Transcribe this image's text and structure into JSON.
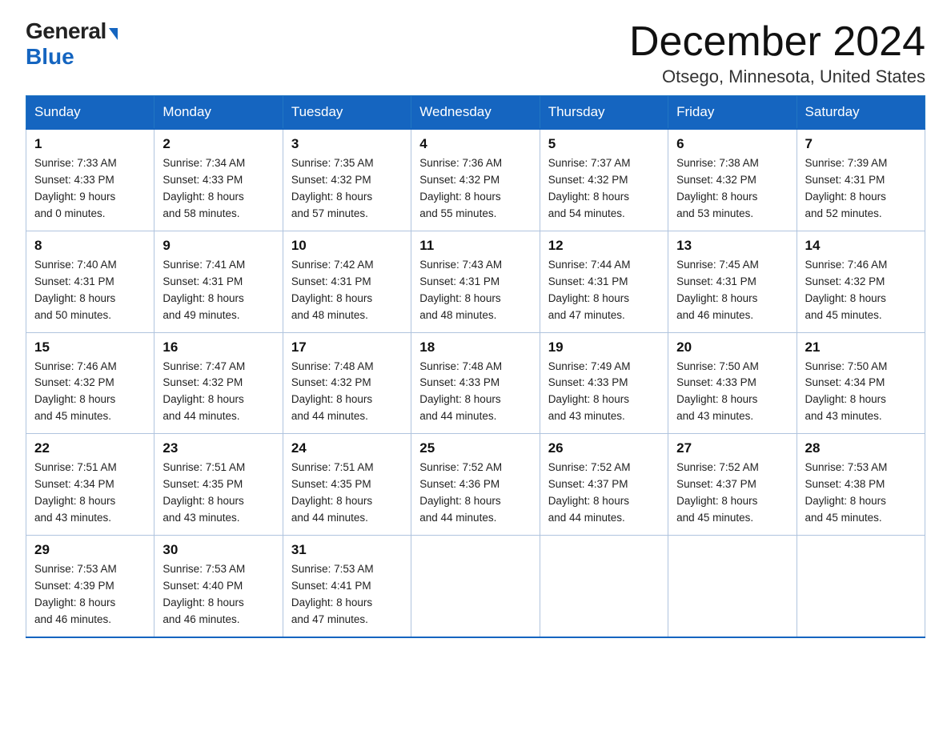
{
  "logo": {
    "general": "General",
    "blue": "Blue",
    "triangle": "▲"
  },
  "title": "December 2024",
  "location": "Otsego, Minnesota, United States",
  "days_of_week": [
    "Sunday",
    "Monday",
    "Tuesday",
    "Wednesday",
    "Thursday",
    "Friday",
    "Saturday"
  ],
  "weeks": [
    [
      {
        "day": "1",
        "sunrise": "7:33 AM",
        "sunset": "4:33 PM",
        "daylight": "9 hours and 0 minutes."
      },
      {
        "day": "2",
        "sunrise": "7:34 AM",
        "sunset": "4:33 PM",
        "daylight": "8 hours and 58 minutes."
      },
      {
        "day": "3",
        "sunrise": "7:35 AM",
        "sunset": "4:32 PM",
        "daylight": "8 hours and 57 minutes."
      },
      {
        "day": "4",
        "sunrise": "7:36 AM",
        "sunset": "4:32 PM",
        "daylight": "8 hours and 55 minutes."
      },
      {
        "day": "5",
        "sunrise": "7:37 AM",
        "sunset": "4:32 PM",
        "daylight": "8 hours and 54 minutes."
      },
      {
        "day": "6",
        "sunrise": "7:38 AM",
        "sunset": "4:32 PM",
        "daylight": "8 hours and 53 minutes."
      },
      {
        "day": "7",
        "sunrise": "7:39 AM",
        "sunset": "4:31 PM",
        "daylight": "8 hours and 52 minutes."
      }
    ],
    [
      {
        "day": "8",
        "sunrise": "7:40 AM",
        "sunset": "4:31 PM",
        "daylight": "8 hours and 50 minutes."
      },
      {
        "day": "9",
        "sunrise": "7:41 AM",
        "sunset": "4:31 PM",
        "daylight": "8 hours and 49 minutes."
      },
      {
        "day": "10",
        "sunrise": "7:42 AM",
        "sunset": "4:31 PM",
        "daylight": "8 hours and 48 minutes."
      },
      {
        "day": "11",
        "sunrise": "7:43 AM",
        "sunset": "4:31 PM",
        "daylight": "8 hours and 48 minutes."
      },
      {
        "day": "12",
        "sunrise": "7:44 AM",
        "sunset": "4:31 PM",
        "daylight": "8 hours and 47 minutes."
      },
      {
        "day": "13",
        "sunrise": "7:45 AM",
        "sunset": "4:31 PM",
        "daylight": "8 hours and 46 minutes."
      },
      {
        "day": "14",
        "sunrise": "7:46 AM",
        "sunset": "4:32 PM",
        "daylight": "8 hours and 45 minutes."
      }
    ],
    [
      {
        "day": "15",
        "sunrise": "7:46 AM",
        "sunset": "4:32 PM",
        "daylight": "8 hours and 45 minutes."
      },
      {
        "day": "16",
        "sunrise": "7:47 AM",
        "sunset": "4:32 PM",
        "daylight": "8 hours and 44 minutes."
      },
      {
        "day": "17",
        "sunrise": "7:48 AM",
        "sunset": "4:32 PM",
        "daylight": "8 hours and 44 minutes."
      },
      {
        "day": "18",
        "sunrise": "7:48 AM",
        "sunset": "4:33 PM",
        "daylight": "8 hours and 44 minutes."
      },
      {
        "day": "19",
        "sunrise": "7:49 AM",
        "sunset": "4:33 PM",
        "daylight": "8 hours and 43 minutes."
      },
      {
        "day": "20",
        "sunrise": "7:50 AM",
        "sunset": "4:33 PM",
        "daylight": "8 hours and 43 minutes."
      },
      {
        "day": "21",
        "sunrise": "7:50 AM",
        "sunset": "4:34 PM",
        "daylight": "8 hours and 43 minutes."
      }
    ],
    [
      {
        "day": "22",
        "sunrise": "7:51 AM",
        "sunset": "4:34 PM",
        "daylight": "8 hours and 43 minutes."
      },
      {
        "day": "23",
        "sunrise": "7:51 AM",
        "sunset": "4:35 PM",
        "daylight": "8 hours and 43 minutes."
      },
      {
        "day": "24",
        "sunrise": "7:51 AM",
        "sunset": "4:35 PM",
        "daylight": "8 hours and 44 minutes."
      },
      {
        "day": "25",
        "sunrise": "7:52 AM",
        "sunset": "4:36 PM",
        "daylight": "8 hours and 44 minutes."
      },
      {
        "day": "26",
        "sunrise": "7:52 AM",
        "sunset": "4:37 PM",
        "daylight": "8 hours and 44 minutes."
      },
      {
        "day": "27",
        "sunrise": "7:52 AM",
        "sunset": "4:37 PM",
        "daylight": "8 hours and 45 minutes."
      },
      {
        "day": "28",
        "sunrise": "7:53 AM",
        "sunset": "4:38 PM",
        "daylight": "8 hours and 45 minutes."
      }
    ],
    [
      {
        "day": "29",
        "sunrise": "7:53 AM",
        "sunset": "4:39 PM",
        "daylight": "8 hours and 46 minutes."
      },
      {
        "day": "30",
        "sunrise": "7:53 AM",
        "sunset": "4:40 PM",
        "daylight": "8 hours and 46 minutes."
      },
      {
        "day": "31",
        "sunrise": "7:53 AM",
        "sunset": "4:41 PM",
        "daylight": "8 hours and 47 minutes."
      },
      null,
      null,
      null,
      null
    ]
  ],
  "labels": {
    "sunrise_prefix": "Sunrise: ",
    "sunset_prefix": "Sunset: ",
    "daylight_prefix": "Daylight: "
  }
}
